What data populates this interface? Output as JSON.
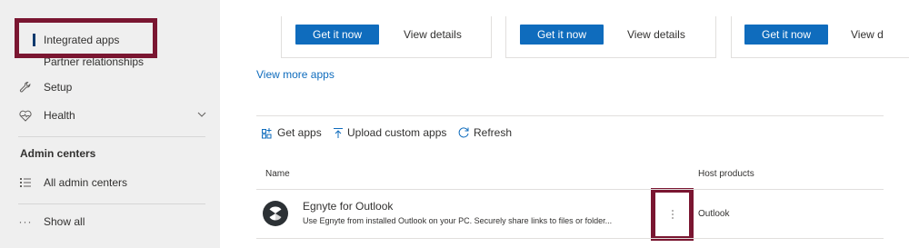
{
  "sidebar": {
    "items": [
      {
        "label": "Integrated apps",
        "icon": "none",
        "active": true
      },
      {
        "label": "Partner relationships",
        "icon": "none"
      },
      {
        "label": "Setup",
        "icon": "wrench-icon"
      },
      {
        "label": "Health",
        "icon": "heart-icon",
        "expandable": true
      }
    ],
    "section_title": "Admin centers",
    "admin_items": [
      {
        "label": "All admin centers",
        "icon": "list-icon"
      },
      {
        "label": "Show all",
        "icon": "ellipsis-icon"
      }
    ]
  },
  "cards": [
    {
      "primary_label": "Get it now",
      "secondary_label": "View details"
    },
    {
      "primary_label": "Get it now",
      "secondary_label": "View details"
    },
    {
      "primary_label": "Get it now",
      "secondary_label": "View d"
    }
  ],
  "view_more_label": "View more apps",
  "toolbar": {
    "get_apps": "Get apps",
    "upload": "Upload custom apps",
    "refresh": "Refresh"
  },
  "table": {
    "headers": {
      "name": "Name",
      "host": "Host products"
    },
    "rows": [
      {
        "name": "Egnyte for Outlook",
        "description": "Use Egnyte from installed Outlook on your PC. Securely share links to files or folder...",
        "more_icon": "more-vertical-icon",
        "host": "Outlook"
      }
    ]
  },
  "colors": {
    "accent": "#0f6cbd",
    "highlight": "#7a1631",
    "sidebar_bg": "#efefef"
  }
}
